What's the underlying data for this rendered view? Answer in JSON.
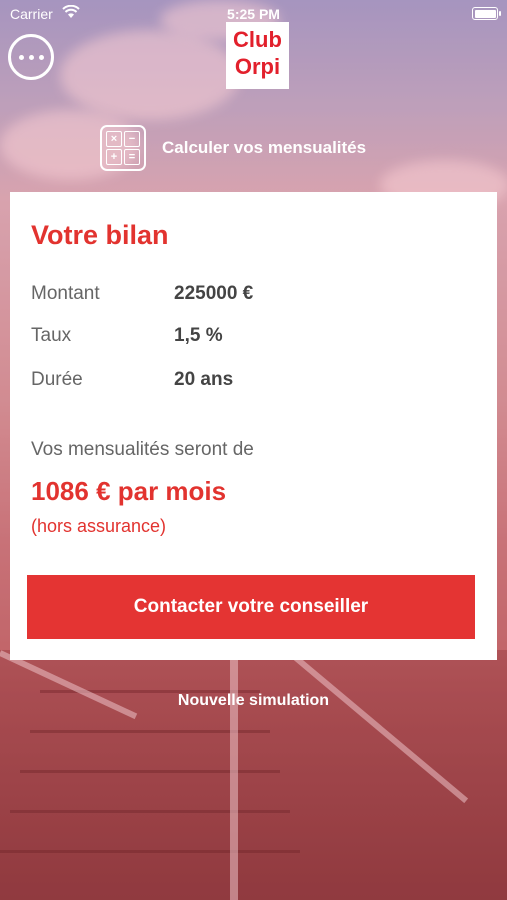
{
  "status_bar": {
    "carrier": "Carrier",
    "time": "5:25 PM"
  },
  "header": {
    "logo_line1": "Club",
    "logo_line2": "Orpi",
    "menu_icon": "ellipsis-icon"
  },
  "calculator": {
    "label": "Calculer vos mensualités",
    "icon": "calculator-icon"
  },
  "result": {
    "title": "Votre bilan",
    "rows": [
      {
        "label": "Montant",
        "value": "225000 €"
      },
      {
        "label": "Taux",
        "value": "1,5 %"
      },
      {
        "label": "Durée",
        "value": "20 ans"
      }
    ],
    "monthly_intro": "Vos mensualités seront de",
    "monthly_value": "1086 € par mois",
    "insurance_note": "(hors assurance)",
    "contact_button": "Contacter votre conseiller"
  },
  "new_simulation": "Nouvelle simulation",
  "colors": {
    "accent": "#e43433",
    "logo_red": "#e2202c"
  }
}
